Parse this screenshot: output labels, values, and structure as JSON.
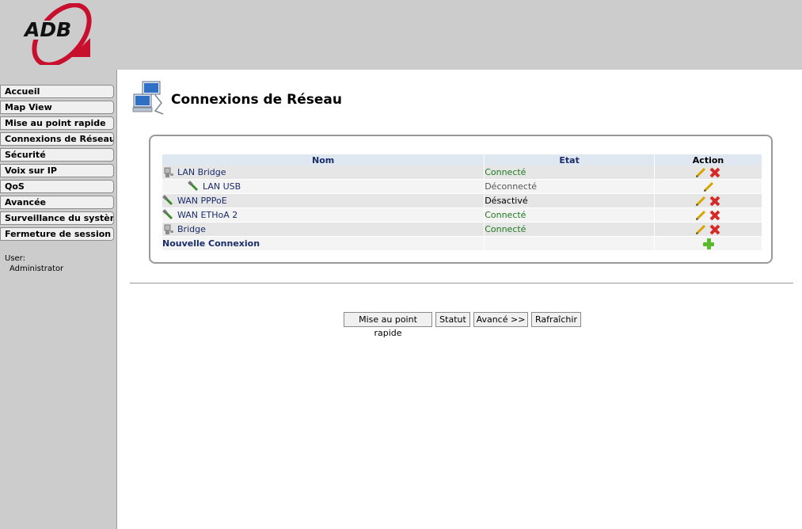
{
  "brand": {
    "logo_text": "ADB",
    "logo_red": "#c8102e"
  },
  "sidebar": {
    "items": [
      {
        "label": "Accueil"
      },
      {
        "label": "Map View"
      },
      {
        "label": "Mise au point rapide"
      },
      {
        "label": "Connexions de Réseau"
      },
      {
        "label": "Sécurité"
      },
      {
        "label": "Voix sur IP"
      },
      {
        "label": "QoS"
      },
      {
        "label": "Avancée"
      },
      {
        "label": "Surveillance du système"
      },
      {
        "label": "Fermeture de session"
      }
    ],
    "user_label": "User:",
    "user_name": "Administrator"
  },
  "page": {
    "title": "Connexions de Réseau",
    "icon": "network-connections-icon"
  },
  "table": {
    "headers": {
      "name": "Nom",
      "state": "Etat",
      "action": "Action"
    },
    "rows": [
      {
        "name": "LAN Bridge",
        "icon": "lan-bridge-icon",
        "state": "Connecté",
        "status": "connected",
        "actions": [
          "edit",
          "delete"
        ]
      },
      {
        "name": "LAN USB",
        "icon": "usb-cable-icon",
        "state": "Déconnecté",
        "status": "disconnected",
        "actions": [
          "edit"
        ]
      },
      {
        "name": "WAN PPPoE",
        "icon": "wan-cable-icon",
        "state": "Désactivé",
        "status": "disabled",
        "actions": [
          "edit",
          "delete"
        ]
      },
      {
        "name": "WAN ETHoA 2",
        "icon": "wan-cable-icon",
        "state": "Connecté",
        "status": "connected",
        "actions": [
          "edit",
          "delete"
        ]
      },
      {
        "name": "Bridge",
        "icon": "bridge-icon",
        "state": "Connecté",
        "status": "connected",
        "actions": [
          "edit",
          "delete"
        ]
      }
    ],
    "new_connection": "Nouvelle Connexion"
  },
  "buttons": {
    "quick_setup": "Mise au point rapide",
    "status": "Statut",
    "advanced": "Avancé >>",
    "refresh": "Rafraîchir"
  },
  "colors": {
    "connected": "#1f7a1f",
    "header_bg": "#dfe7f0",
    "link": "#1a2c6a",
    "chrome": "#cccccc"
  }
}
